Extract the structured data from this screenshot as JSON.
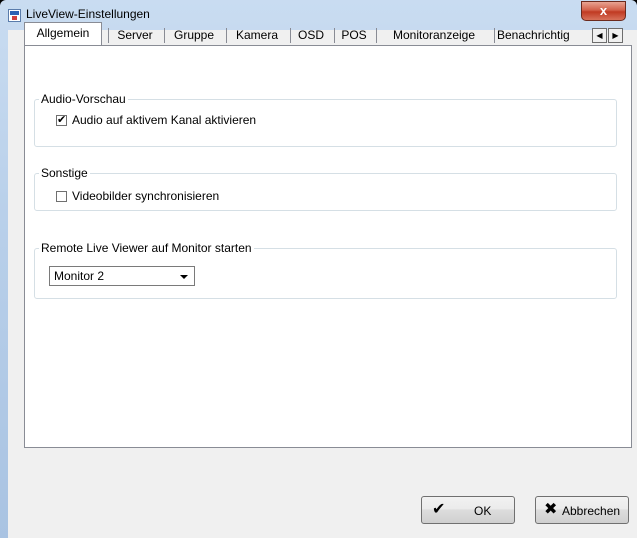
{
  "window": {
    "title": "LiveView-Einstellungen",
    "close_glyph": "x",
    "app_icon": "app-icon"
  },
  "tabs": [
    {
      "label": "Allgemein",
      "active": true
    },
    {
      "label": "Server",
      "active": false
    },
    {
      "label": "Gruppe",
      "active": false
    },
    {
      "label": "Kamera",
      "active": false
    },
    {
      "label": "OSD",
      "active": false
    },
    {
      "label": "POS",
      "active": false
    },
    {
      "label": "Monitoranzeige",
      "active": false
    },
    {
      "label": "Benachrichtig",
      "active": false
    }
  ],
  "tab_scroll": {
    "left": "◀",
    "right": "▶"
  },
  "groups": {
    "audio": {
      "legend": "Audio-Vorschau",
      "checkbox_label": "Audio auf aktivem Kanal aktivieren",
      "checked": true,
      "check_glyph": "✔"
    },
    "misc": {
      "legend": "Sonstige",
      "checkbox_label": "Videobilder synchronisieren",
      "checked": false,
      "check_glyph": ""
    },
    "remote": {
      "legend": "Remote Live Viewer auf Monitor starten",
      "select_value": "Monitor 2"
    }
  },
  "buttons": {
    "ok": {
      "label": "OK",
      "icon": "checkmark-icon",
      "glyph": "✔"
    },
    "cancel": {
      "label": "Abbrechen",
      "icon": "x-icon",
      "glyph": "✖"
    }
  },
  "colors": {
    "close_button": "#c03a22",
    "title_bar": "#c9dcf1",
    "panel_bg": "#ffffff"
  }
}
